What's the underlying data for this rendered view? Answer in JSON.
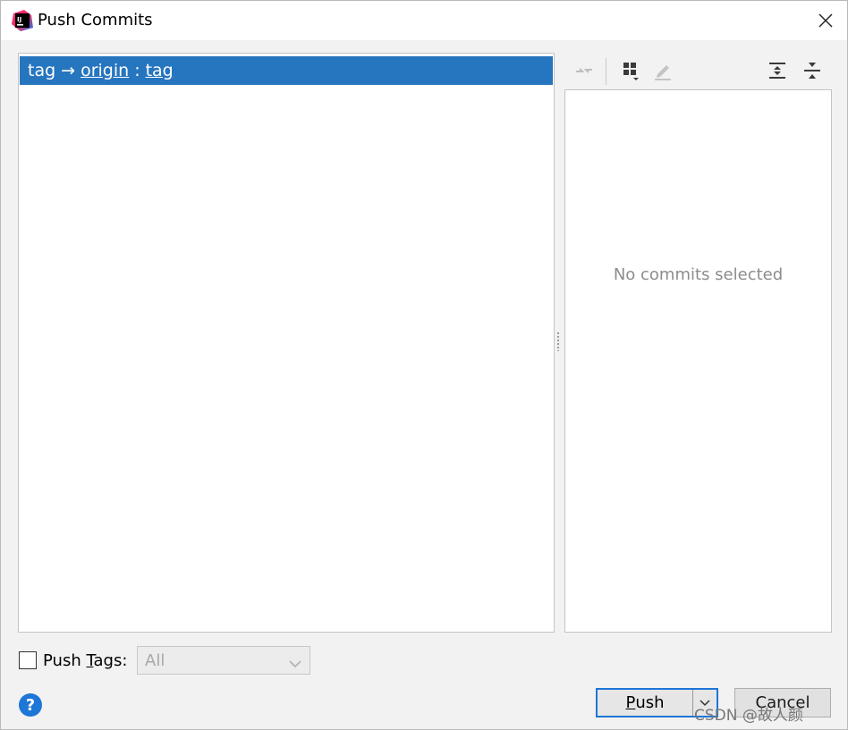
{
  "window": {
    "title": "Push Commits",
    "app_icon": "intellij-idea-icon",
    "close_icon": "close-icon"
  },
  "push_list": {
    "rows": [
      {
        "local_branch": "tag",
        "arrow": "→",
        "remote": "origin",
        "separator": ":",
        "remote_branch": "tag",
        "selected": true
      }
    ]
  },
  "toolbar": {
    "icons": [
      "collapse-arrows-icon",
      "group-by-icon",
      "edit-icon",
      "expand-all-icon",
      "collapse-all-icon"
    ]
  },
  "details": {
    "empty_text": "No commits selected"
  },
  "options": {
    "push_tags_label_pre": "Push ",
    "push_tags_label_mnemonic": "T",
    "push_tags_label_post": "ags:",
    "push_tags_checked": false,
    "tags_select_value": "All"
  },
  "footer": {
    "help_icon": "question-icon",
    "help_text": "?",
    "push_label_mnemonic": "P",
    "push_label_rest": "ush",
    "cancel_label": "Cancel"
  },
  "watermark": "CSDN @故人颜",
  "colors": {
    "selection": "#2675bf",
    "accent": "#1e76d6"
  }
}
